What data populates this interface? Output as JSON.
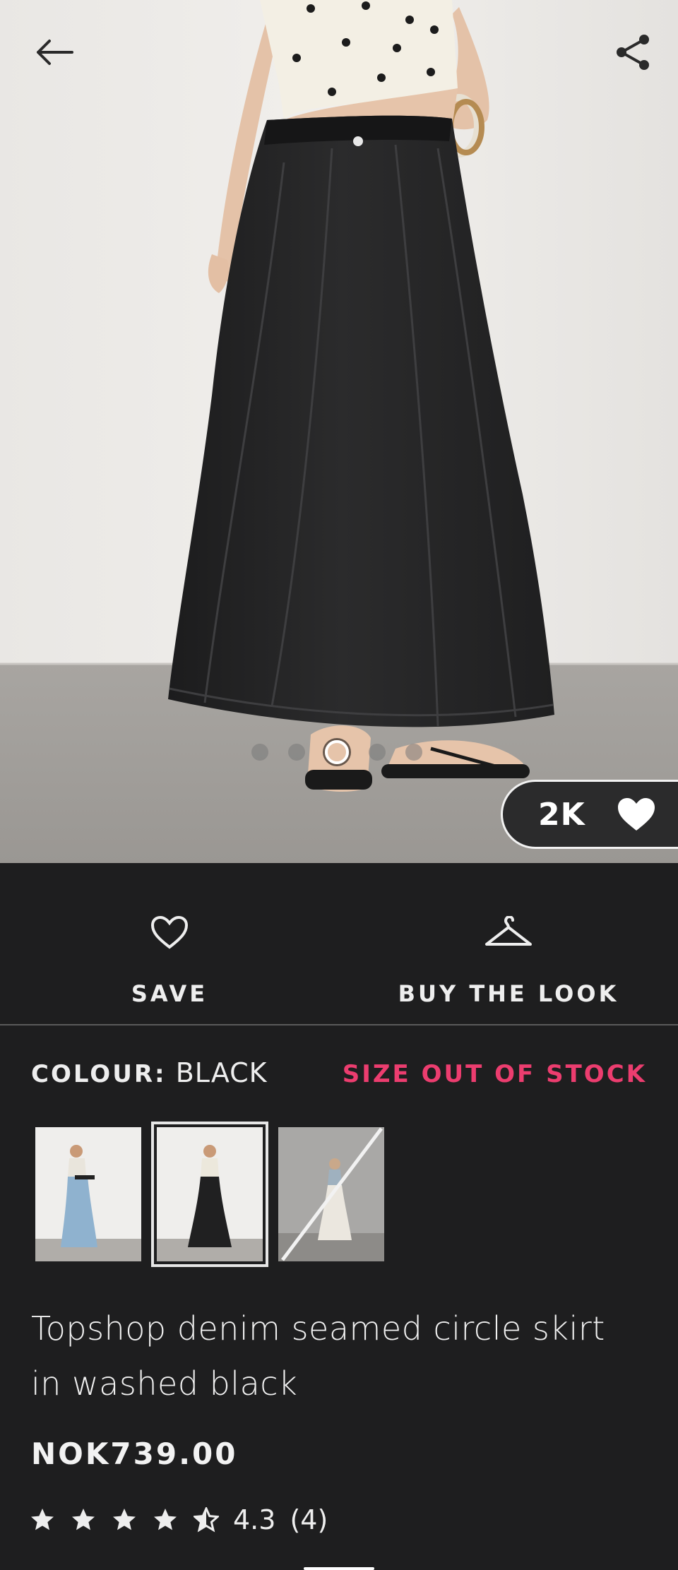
{
  "hero": {
    "likes_count": "2K",
    "carousel": {
      "total": 5,
      "active_index": 2
    }
  },
  "icons": {
    "back": "arrow-left-icon",
    "share": "share-icon",
    "likes": "heart-filled-icon",
    "save": "heart-outline-icon",
    "buy_the_look": "hanger-icon",
    "star_full": "star-icon",
    "star_half": "star-half-icon"
  },
  "actions": {
    "save_label": "SAVE",
    "buy_the_look_label": "BUY THE LOOK"
  },
  "colour": {
    "key_label": "COLOUR:",
    "value": "BLACK",
    "stock_notice": "SIZE OUT OF STOCK",
    "swatches": [
      {
        "name": "light-blue",
        "selected": false,
        "out_of_stock": false
      },
      {
        "name": "black",
        "selected": true,
        "out_of_stock": false
      },
      {
        "name": "ecru",
        "selected": false,
        "out_of_stock": true
      }
    ]
  },
  "product": {
    "title": "Topshop denim seamed circle skirt in washed black",
    "price": "NOK739.00",
    "rating": {
      "value": "4.3",
      "count": "(4)",
      "stars": 4.3,
      "max": 5
    }
  },
  "colors": {
    "background": "#1e1e1f",
    "accent_pink": "#ec3d6f",
    "text": "#eeeeee"
  }
}
